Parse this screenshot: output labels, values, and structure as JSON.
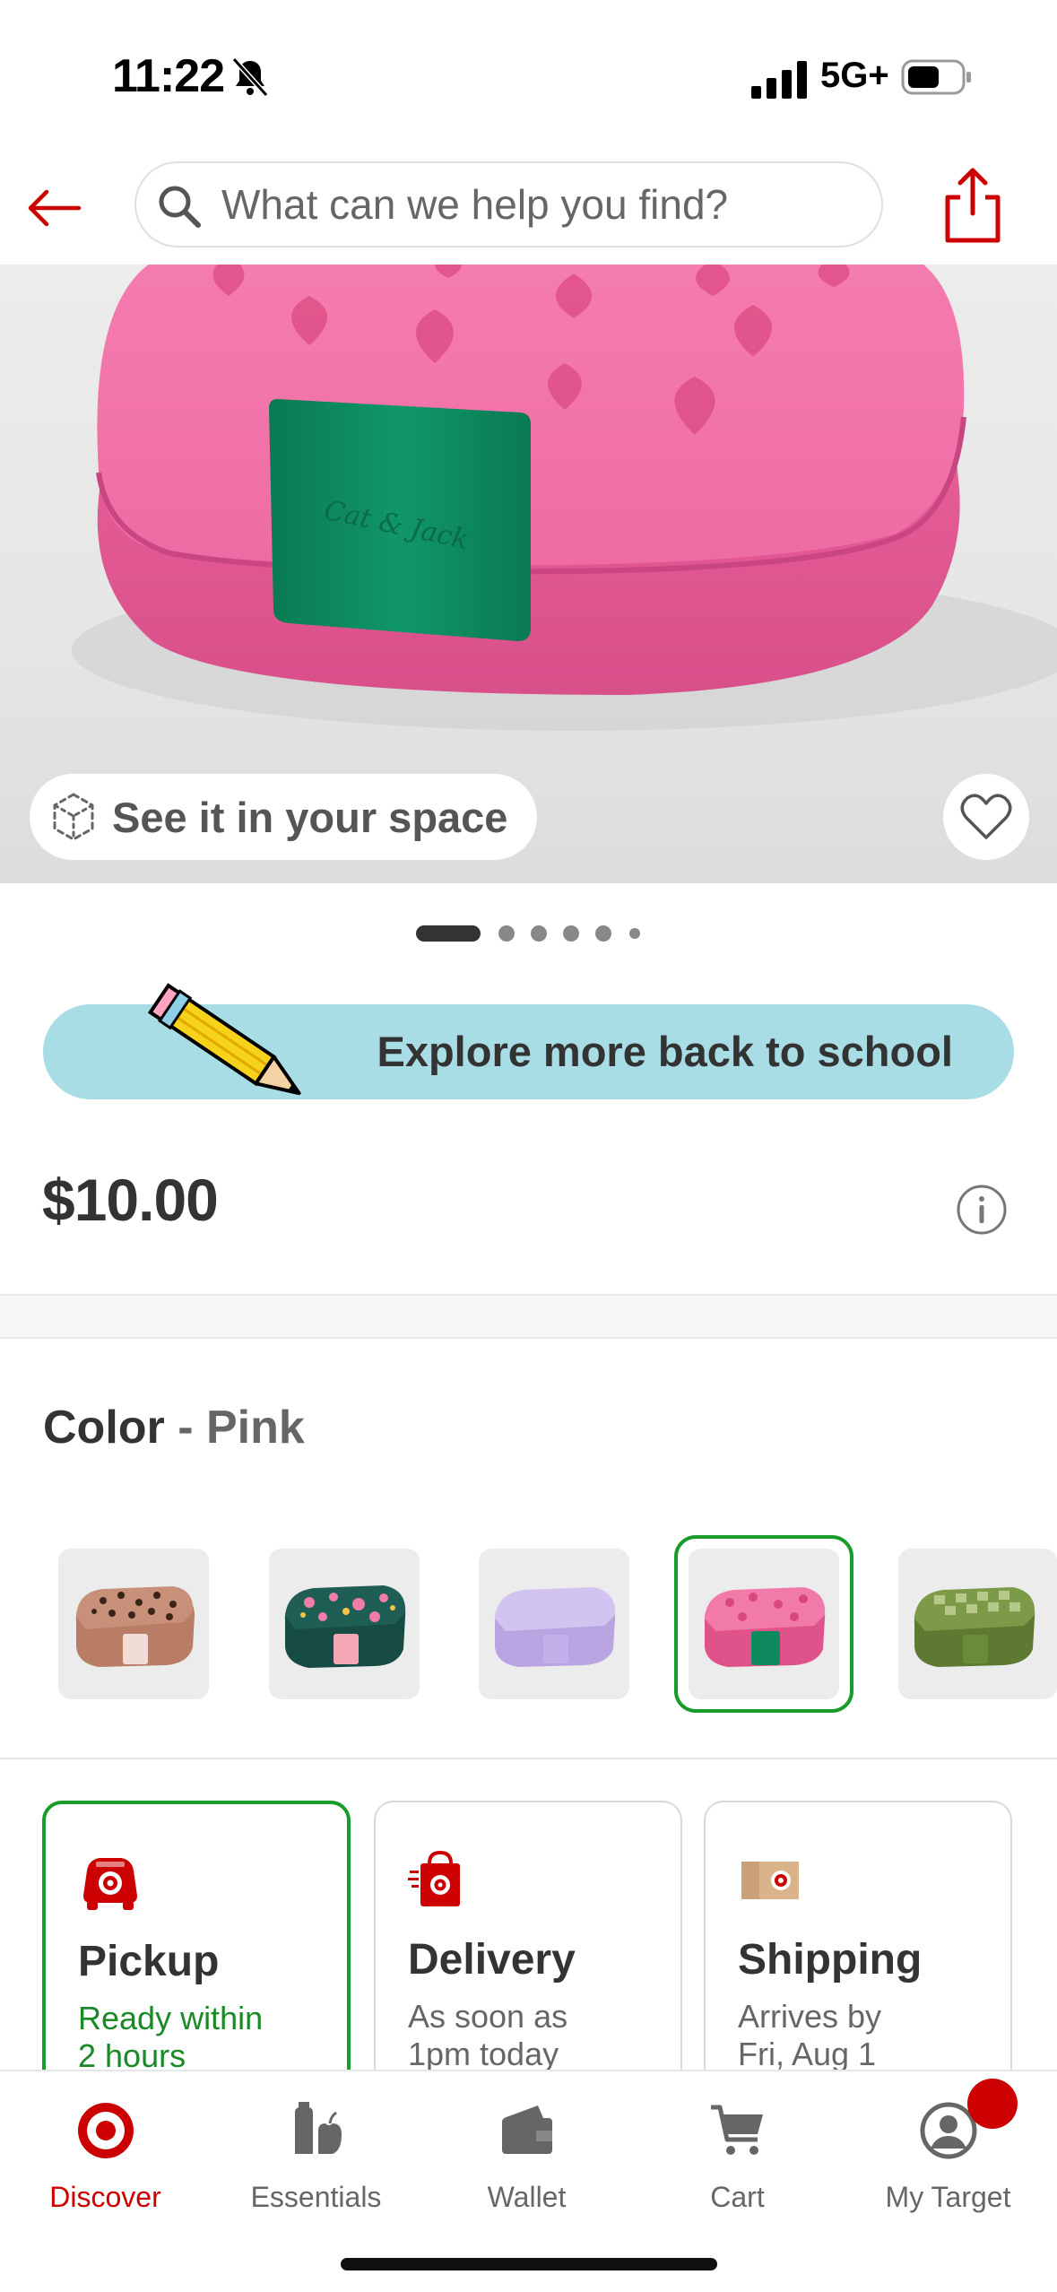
{
  "status_bar": {
    "time": "11:22",
    "network": "5G+"
  },
  "header": {
    "search_placeholder": "What can we help you find?"
  },
  "product": {
    "see_in_space_label": "See it in your space",
    "brand_on_clasp": "Cat & Jack",
    "carousel": {
      "total": 6,
      "active_index": 0
    },
    "promo_label": "Explore more back to school",
    "price": "$10.00"
  },
  "color": {
    "title": "Color",
    "separator": " - ",
    "selected": "Pink",
    "swatches": [
      {
        "name": "leopard",
        "color": "#c08a70"
      },
      {
        "name": "floral-green",
        "color": "#1f5c52"
      },
      {
        "name": "lavender",
        "color": "#cfc0ec"
      },
      {
        "name": "pink-strawberry",
        "color": "#ef6fa0",
        "selected": true
      },
      {
        "name": "green-checker",
        "color": "#6f8b3e"
      }
    ]
  },
  "fulfillment": [
    {
      "title": "Pickup",
      "sub1": "Ready within",
      "sub2": "2 hours",
      "selected": true
    },
    {
      "title": "Delivery",
      "sub1": "As soon as",
      "sub2": "1pm today",
      "selected": false
    },
    {
      "title": "Shipping",
      "sub1": "Arrives by",
      "sub2": "Fri, Aug 1",
      "selected": false
    }
  ],
  "bottom_nav": [
    {
      "label": "Discover",
      "active": true
    },
    {
      "label": "Essentials",
      "active": false
    },
    {
      "label": "Wallet",
      "active": false
    },
    {
      "label": "Cart",
      "active": false
    },
    {
      "label": "My Target",
      "active": false
    }
  ],
  "colors": {
    "brand_red": "#cc0000",
    "select_green": "#1a9c2a",
    "promo_blue": "#a8dde6",
    "product_pink": "#ef6fa0",
    "clasp_green": "#0f8a5f"
  }
}
